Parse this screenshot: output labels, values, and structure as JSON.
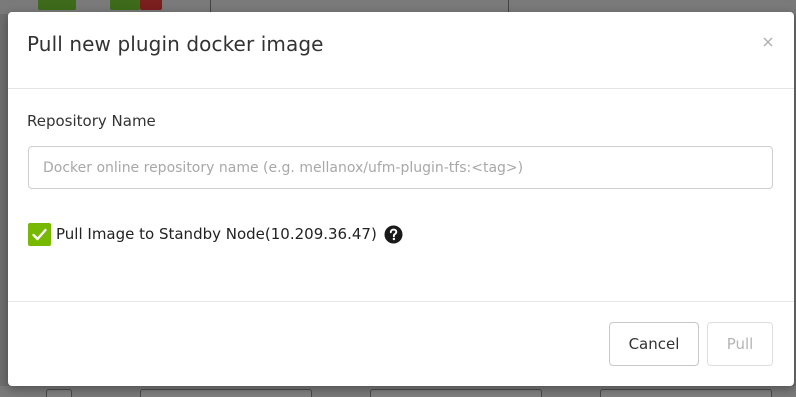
{
  "dialog": {
    "title": "Pull new plugin docker image",
    "close_label": "×"
  },
  "form": {
    "repository_label": "Repository Name",
    "repository_placeholder": "Docker online repository name (e.g. mellanox/ufm-plugin-tfs:<tag>)",
    "repository_value": "",
    "standby_checkbox": {
      "label": "Pull Image to Standby Node(10.209.36.47)",
      "checked": true
    },
    "help_icon": "question-circle-icon"
  },
  "footer": {
    "cancel_label": "Cancel",
    "pull_label": "Pull",
    "pull_enabled": false
  },
  "colors": {
    "checkbox_accent": "#76b900",
    "overlay": "#6e6e6e",
    "disabled_text": "#b5b5b5"
  }
}
